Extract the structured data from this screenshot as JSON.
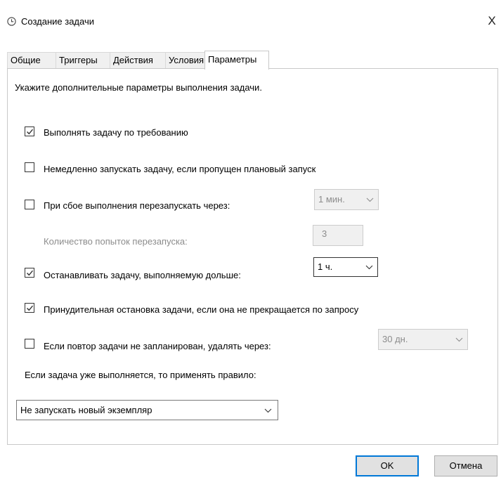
{
  "window": {
    "title": "Создание задачи",
    "icon": "clock-icon",
    "close_glyph": "X"
  },
  "tabs": [
    {
      "label": "Общие",
      "active": false
    },
    {
      "label": "Триггеры",
      "active": false
    },
    {
      "label": "Действия",
      "active": false
    },
    {
      "label": "Условия",
      "active": false
    },
    {
      "label": "Параметры",
      "active": true
    }
  ],
  "panel": {
    "description": "Укажите дополнительные параметры выполнения задачи.",
    "options": {
      "run_on_demand": {
        "label": "Выполнять задачу по требованию",
        "checked": true
      },
      "run_missed": {
        "label": "Немедленно запускать задачу, если пропущен плановый запуск",
        "checked": false
      },
      "restart_on_fail": {
        "label": "При сбое выполнения перезапускать через:",
        "checked": false
      },
      "stop_if_longer": {
        "label": "Останавливать задачу, выполняемую дольше:",
        "checked": true
      },
      "force_stop": {
        "label": "Принудительная остановка задачи, если она не прекращается по запросу",
        "checked": true
      },
      "delete_if_not_scheduled": {
        "label": "Если повтор задачи не запланирован, удалять через:",
        "checked": false
      }
    },
    "restart_interval": {
      "value": "1 мин.",
      "enabled": false
    },
    "restart_attempts": {
      "label": "Количество попыток перезапуска:",
      "value": "3",
      "enabled": false
    },
    "stop_after": {
      "value": "1 ч.",
      "enabled": true
    },
    "delete_after": {
      "value": "30 дн.",
      "enabled": false
    },
    "rule_label": "Если задача уже выполняется, то применять правило:",
    "rule_select": {
      "value": "Не запускать новый экземпляр"
    }
  },
  "buttons": {
    "ok": "OK",
    "cancel": "Отмена"
  },
  "colors": {
    "accent": "#0078d7",
    "disabled_text": "#8c8c8c",
    "disabled_bg": "#f0f0f0"
  }
}
